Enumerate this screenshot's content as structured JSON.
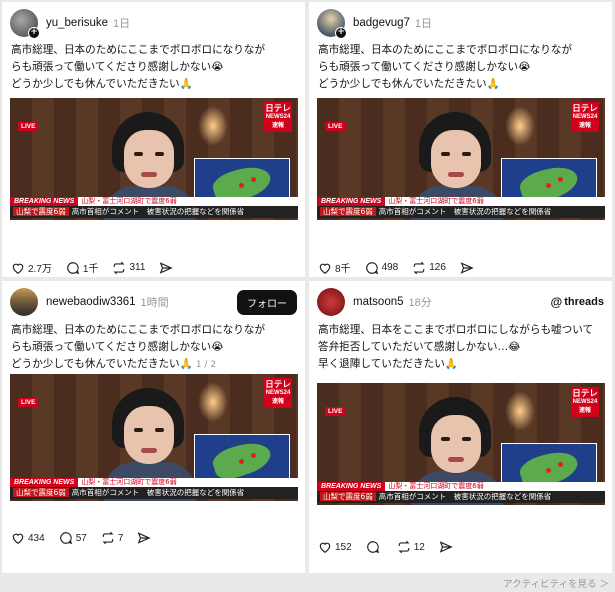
{
  "posts": [
    {
      "username": "yu_berisuke",
      "time": "1日",
      "lines": [
        "高市総理、日本のためにここまでボロボロになりなが",
        "らも頑張って働いてくださり感謝しかない😭",
        "どうか少しでも休んでいただきたい🙏"
      ],
      "likes": "2.7万",
      "replies": "1千",
      "reposts": "311"
    },
    {
      "username": "badgevug7",
      "time": "1日",
      "lines": [
        "高市総理、日本のためにここまでボロボロになりなが",
        "らも頑張って働いてくださり感謝しかない😭",
        "どうか少しでも休んでいただきたい🙏"
      ],
      "likes": "8千",
      "replies": "498",
      "reposts": "126"
    },
    {
      "username": "newebaodiw3361",
      "time": "1時間",
      "follow_label": "フォロー",
      "lines": [
        "高市総理、日本のためにここまでボロボロになりなが",
        "らも頑張って働いてくださり感謝しかない😭",
        "どうか少しでも休んでいただきたい🙏"
      ],
      "pager": "1 / 2",
      "likes": "434",
      "replies": "57",
      "reposts": "7"
    },
    {
      "username": "matsoon5",
      "time": "18分",
      "brand": "threads",
      "lines": [
        "高市総理、日本をここまでボロボロにしながらも嘘ついて",
        "答弁拒否していただいて感謝しかない…😂",
        "早く退陣していただきたい🙏"
      ],
      "likes": "152",
      "replies": "",
      "reposts": "12"
    }
  ],
  "video": {
    "live": "LIVE",
    "logo_top": "日テレ",
    "logo_mid": "NEWS24",
    "logo_bottom": "速報",
    "breaking": "BREAKING NEWS",
    "ticker": "山梨・富士河口湖町で震度6弱",
    "caption_tag": "山梨で震度6弱",
    "caption": "高市首相がコメント　被害状況の把握などを関係省"
  },
  "footer": "アクティビティを見る ＞"
}
